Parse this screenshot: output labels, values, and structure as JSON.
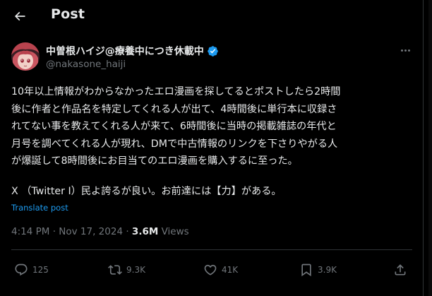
{
  "header": {
    "title": "Post"
  },
  "author": {
    "display_name": "中曽根ハイジ@療養中につき休載中",
    "handle": "@nakasone_haiji"
  },
  "post": {
    "lines": [
      "10年以上情報がわからなかったエロ漫画を探してるとポストしたら2時間",
      "後に作者と作品名を特定してくれる人が出て、4時間後に単行本に収録さ",
      "れてない事を教えてくれる人が来て、6時間後に当時の掲載雑誌の年代と",
      "月号を調べてくれる人が現れ、DMで中古情報のリンクを下さりやがる人",
      "が爆誕して8時間後にお目当てのエロ漫画を購入するに至った。"
    ],
    "paragraph2": "X （Twitter Ⅰ）民よ誇るが良い。お前達には【力】がある。",
    "translate_label": "Translate post"
  },
  "meta": {
    "time": "4:14 PM",
    "separator": " · ",
    "date": "Nov 17, 2024",
    "views_count": "3.6M",
    "views_label": " Views"
  },
  "actions": {
    "replies": "125",
    "reposts": "9.3K",
    "likes": "41K",
    "bookmarks": "3.9K"
  },
  "icons": {
    "back": "arrow-left-icon",
    "verified": "verified-badge-icon",
    "more": "more-horizontal-icon",
    "reply": "reply-icon",
    "repost": "repost-icon",
    "like": "heart-icon",
    "bookmark": "bookmark-icon",
    "share": "share-icon"
  },
  "colors": {
    "background": "#000000",
    "text": "#e7e9ea",
    "secondary": "#71767b",
    "accent": "#1d9bf0"
  }
}
